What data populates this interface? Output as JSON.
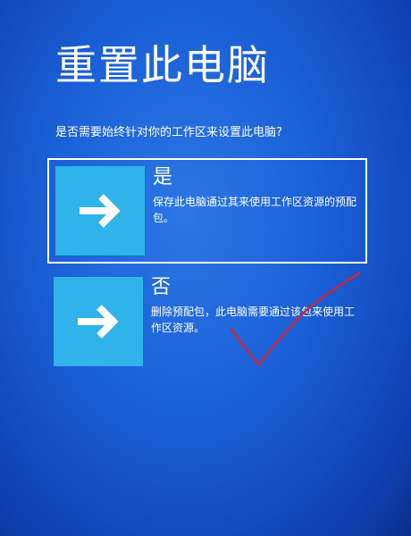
{
  "title": "重置此电脑",
  "question": "是否需要始终针对你的工作区来设置此电脑?",
  "options": [
    {
      "title": "是",
      "description": "保存此电脑通过其来使用工作区资源的预配包。",
      "icon": "arrow-right-icon",
      "selected": true
    },
    {
      "title": "否",
      "description": "删除预配包，此电脑需要通过该包来使用工作区资源。",
      "icon": "arrow-right-icon",
      "selected": false
    }
  ],
  "colors": {
    "background": "#1a5fd6",
    "tile": "#2fb3e8",
    "text": "#ffffff",
    "selection_border": "#ffffff",
    "checkmark_annotation": "#c8283c"
  },
  "annotation": "red-checkmark"
}
